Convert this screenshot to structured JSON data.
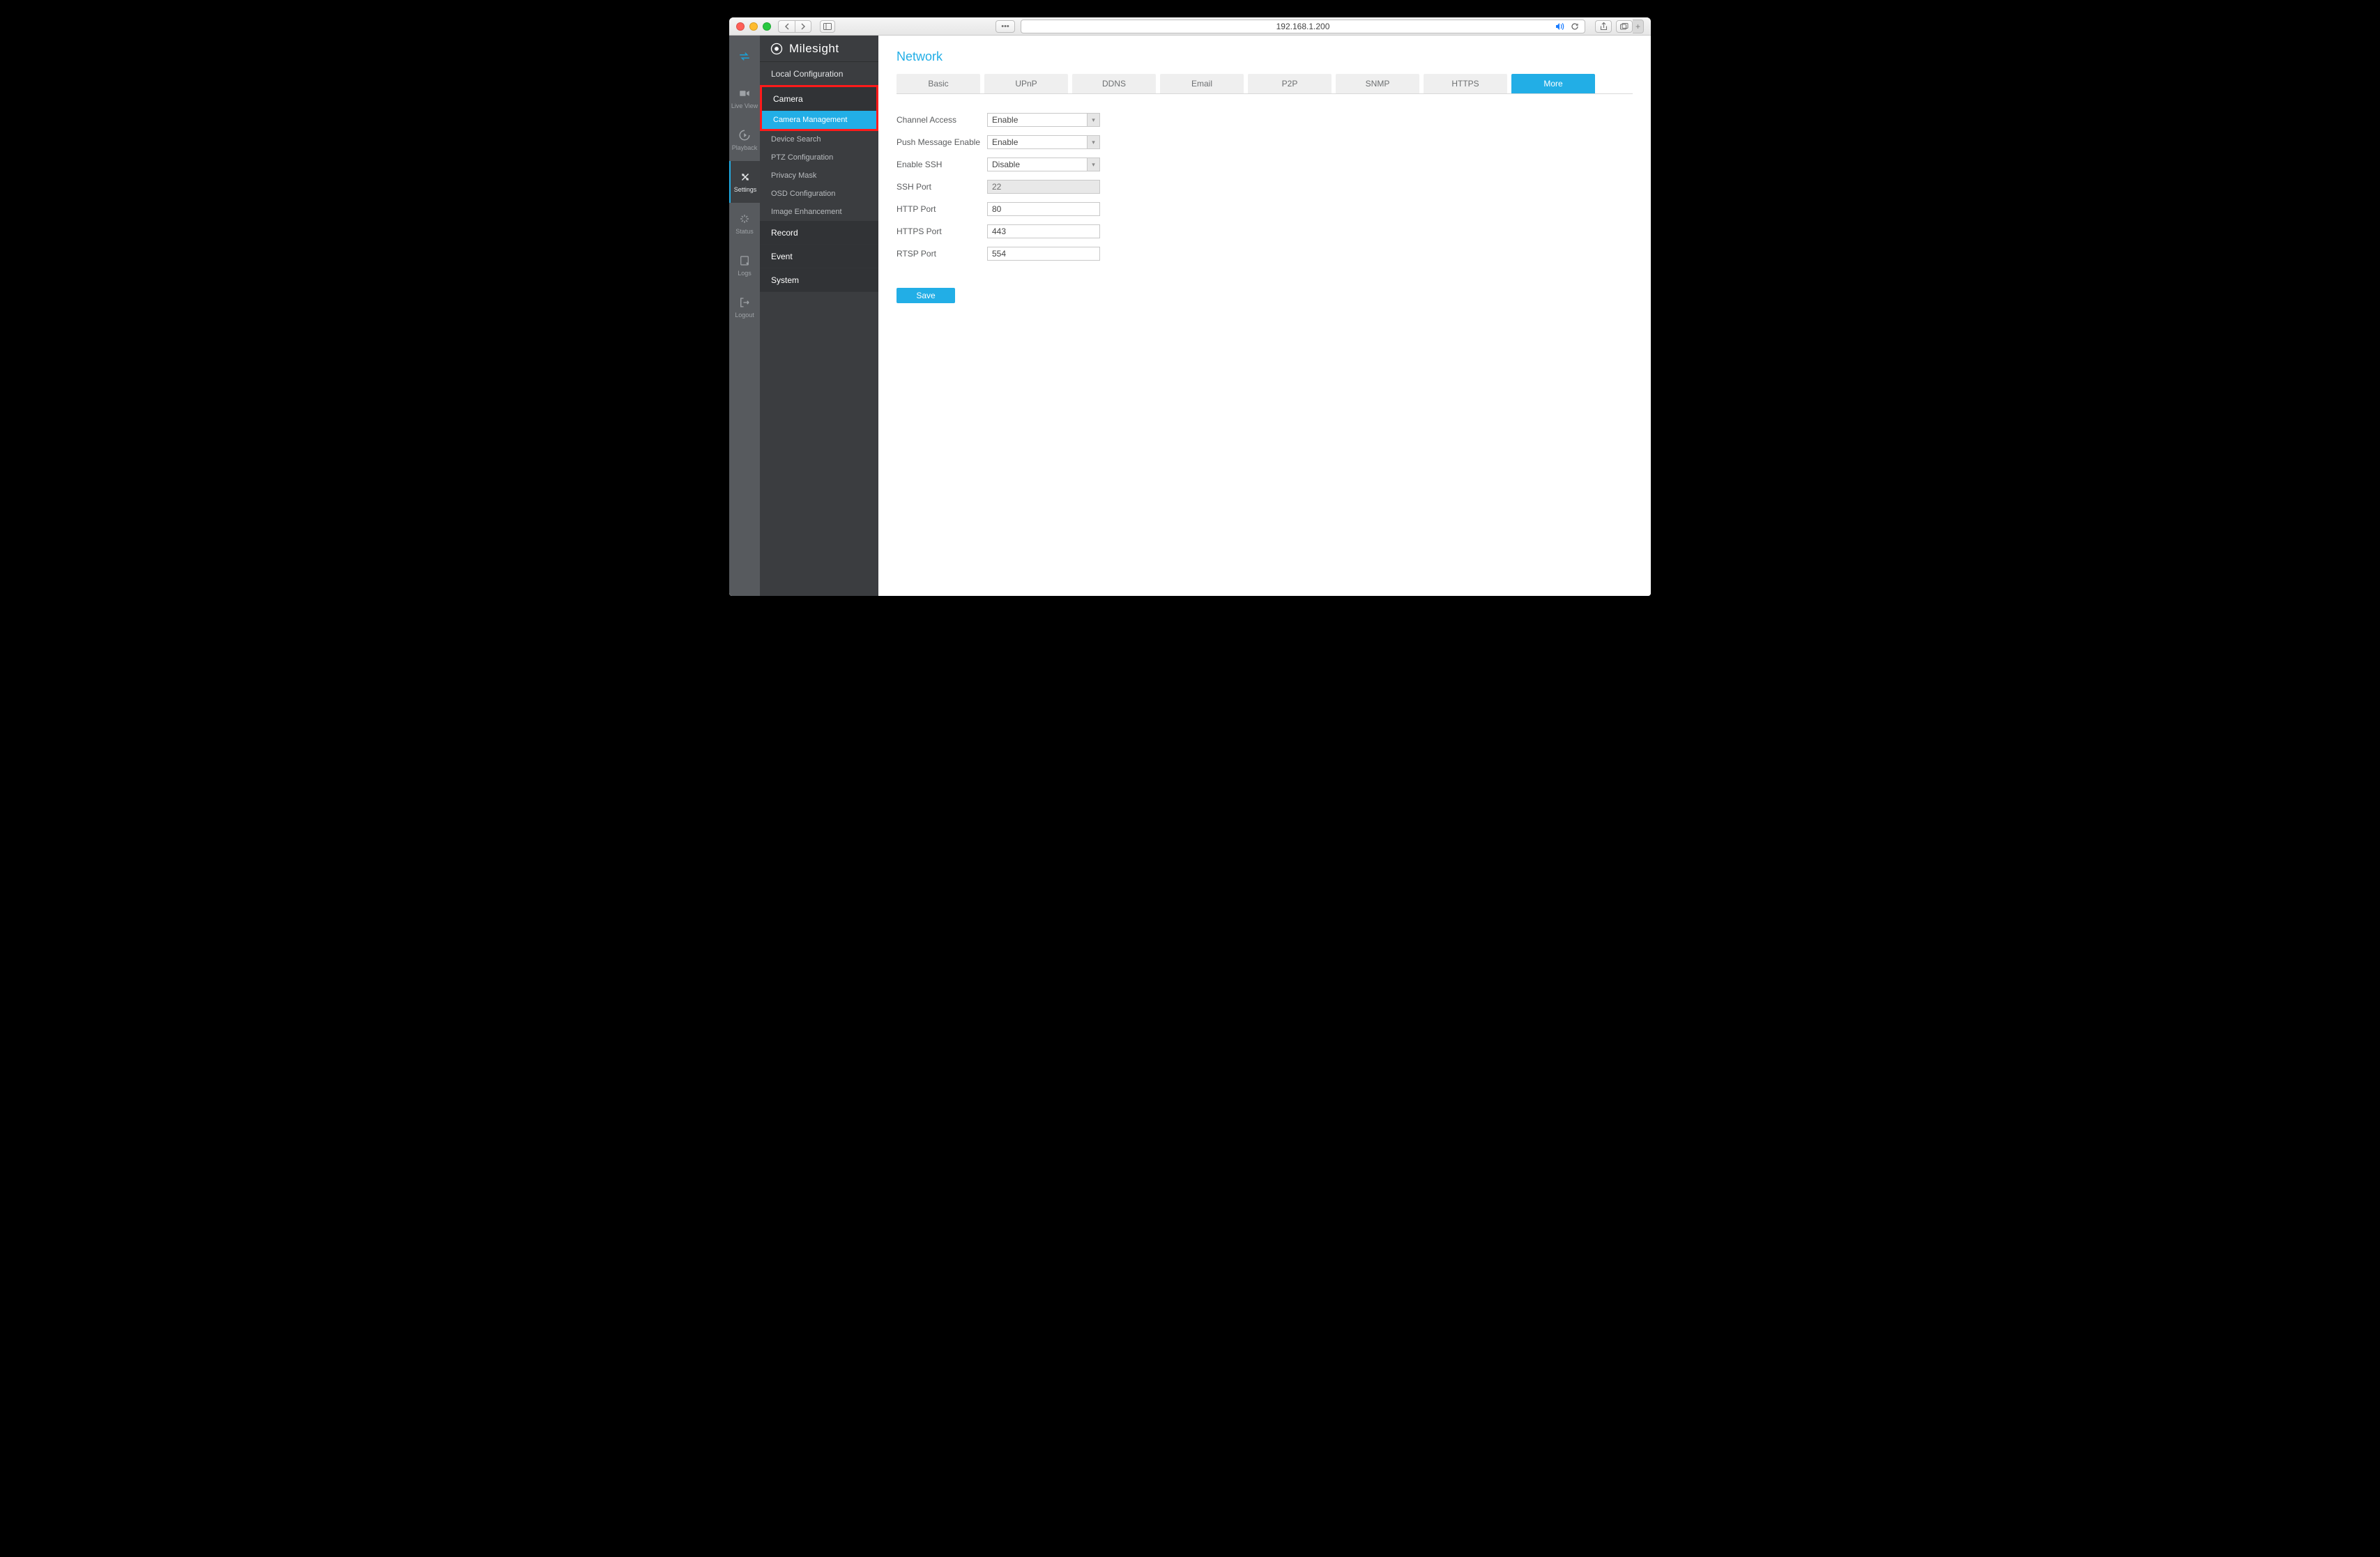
{
  "browser": {
    "url": "192.168.1.200"
  },
  "brand": "Milesight",
  "rail": {
    "items": [
      {
        "id": "arrows",
        "label": ""
      },
      {
        "id": "liveview",
        "label": "Live View"
      },
      {
        "id": "playback",
        "label": "Playback"
      },
      {
        "id": "settings",
        "label": "Settings"
      },
      {
        "id": "status",
        "label": "Status"
      },
      {
        "id": "logs",
        "label": "Logs"
      },
      {
        "id": "logout",
        "label": "Logout"
      }
    ]
  },
  "sidebar": {
    "local_config": "Local Configuration",
    "camera": "Camera",
    "camera_items": [
      {
        "id": "camera-mgmt",
        "label": "Camera Management"
      },
      {
        "id": "device-search",
        "label": "Device Search"
      },
      {
        "id": "ptz-config",
        "label": "PTZ Configuration"
      },
      {
        "id": "privacy-mask",
        "label": "Privacy Mask"
      },
      {
        "id": "osd-config",
        "label": "OSD Configuration"
      },
      {
        "id": "image-enh",
        "label": "Image Enhancement"
      }
    ],
    "record": "Record",
    "event": "Event",
    "system": "System"
  },
  "page": {
    "title": "Network",
    "tabs": [
      "Basic",
      "UPnP",
      "DDNS",
      "Email",
      "P2P",
      "SNMP",
      "HTTPS",
      "More"
    ],
    "active_tab": "More"
  },
  "form": {
    "channel_access": {
      "label": "Channel Access",
      "value": "Enable"
    },
    "push_message": {
      "label": "Push Message Enable",
      "value": "Enable"
    },
    "enable_ssh": {
      "label": "Enable SSH",
      "value": "Disable"
    },
    "ssh_port": {
      "label": "SSH Port",
      "value": "22",
      "readonly": true
    },
    "http_port": {
      "label": "HTTP Port",
      "value": "80"
    },
    "https_port": {
      "label": "HTTPS Port",
      "value": "443"
    },
    "rtsp_port": {
      "label": "RTSP Port",
      "value": "554"
    },
    "save": "Save"
  }
}
